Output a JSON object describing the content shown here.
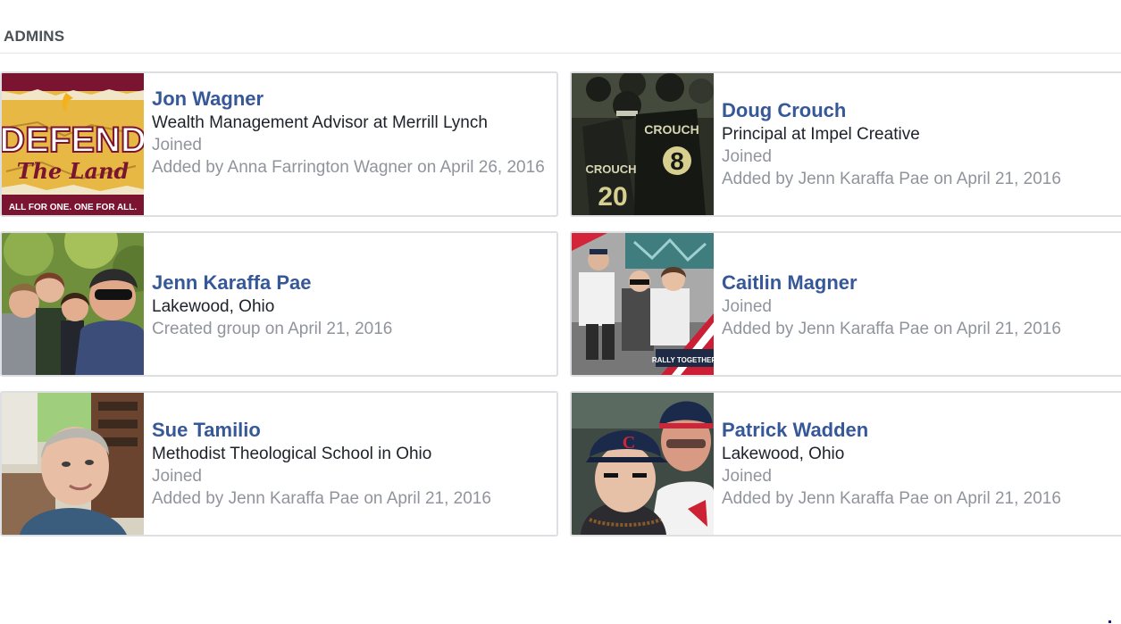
{
  "section": {
    "title": "ADMINS"
  },
  "members": [
    {
      "name": "Jon Wagner",
      "line1": "Wealth Management Advisor at Merrill Lynch",
      "line2": "Joined",
      "line3": "Added by Anna Farrington Wagner on April 26, 2016",
      "photo_text": {
        "top": "DEFEND",
        "script": "The Land",
        "bottom": "ALL FOR ONE. ONE FOR ALL."
      }
    },
    {
      "name": "Doug Crouch",
      "line1": "Principal at Impel Creative",
      "line2": "Joined",
      "line3": "Added by Jenn Karaffa Pae on April 21, 2016",
      "photo_text": {
        "jersey_a": "CROUCH",
        "num_a": "8",
        "jersey_b": "CROUCH",
        "num_b": "20"
      }
    },
    {
      "name": "Jenn Karaffa Pae",
      "line1": "Lakewood, Ohio",
      "line2": "Created group on April 21, 2016",
      "line3": ""
    },
    {
      "name": "Caitlin Magner",
      "line1": "",
      "line2": "Joined",
      "line3": "Added by Jenn Karaffa Pae on April 21, 2016",
      "photo_text": {
        "banner": "RALLY TOGETHER"
      }
    },
    {
      "name": "Sue Tamilio",
      "line1": "Methodist Theological School in Ohio",
      "line2": "Joined",
      "line3": "Added by Jenn Karaffa Pae on April 21, 2016"
    },
    {
      "name": "Patrick Wadden",
      "line1": "Lakewood, Ohio",
      "line2": "Joined",
      "line3": "Added by Jenn Karaffa Pae on April 21, 2016"
    }
  ]
}
